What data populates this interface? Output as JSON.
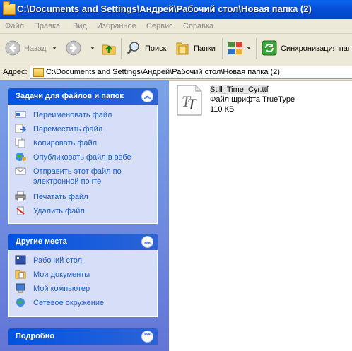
{
  "window": {
    "title": "C:\\Documents and Settings\\Андрей\\Рабочий стол\\Новая папка (2)"
  },
  "menu": [
    "Файл",
    "Правка",
    "Вид",
    "Избранное",
    "Сервис",
    "Справка"
  ],
  "toolbar": {
    "back_label": "Назад",
    "search_label": "Поиск",
    "folders_label": "Папки",
    "sync_label": "Синхронизация папки"
  },
  "address": {
    "label": "Адрес:",
    "value": "C:\\Documents and Settings\\Андрей\\Рабочий стол\\Новая папка (2)"
  },
  "tasks_panel": {
    "title": "Задачи для файлов и папок",
    "items": [
      {
        "label": "Переименовать файл",
        "icon": "rename-icon"
      },
      {
        "label": "Переместить файл",
        "icon": "move-icon"
      },
      {
        "label": "Копировать файл",
        "icon": "copy-icon"
      },
      {
        "label": "Опубликовать файл в вебе",
        "icon": "publish-web-icon"
      },
      {
        "label": "Отправить этот файл по электронной почте",
        "icon": "email-icon"
      },
      {
        "label": "Печатать файл",
        "icon": "print-icon"
      },
      {
        "label": "Удалить файл",
        "icon": "delete-icon"
      }
    ]
  },
  "other_places_panel": {
    "title": "Другие места",
    "items": [
      {
        "label": "Рабочий стол",
        "icon": "desktop-icon"
      },
      {
        "label": "Мои документы",
        "icon": "my-documents-icon"
      },
      {
        "label": "Мой компьютер",
        "icon": "my-computer-icon"
      },
      {
        "label": "Сетевое окружение",
        "icon": "network-icon"
      }
    ]
  },
  "details_panel": {
    "title": "Подробно"
  },
  "file": {
    "name": "Still_Time_Cyr.ttf",
    "type": "Файл шрифта TrueType",
    "size": "110 КБ",
    "icon": "truetype-font-icon"
  },
  "colors": {
    "titlebar": "#0a5fe8",
    "pane_top": "#7ba2e7",
    "pane_bottom": "#6375d6",
    "link": "#215dc6",
    "box_body": "#d6dff7"
  }
}
